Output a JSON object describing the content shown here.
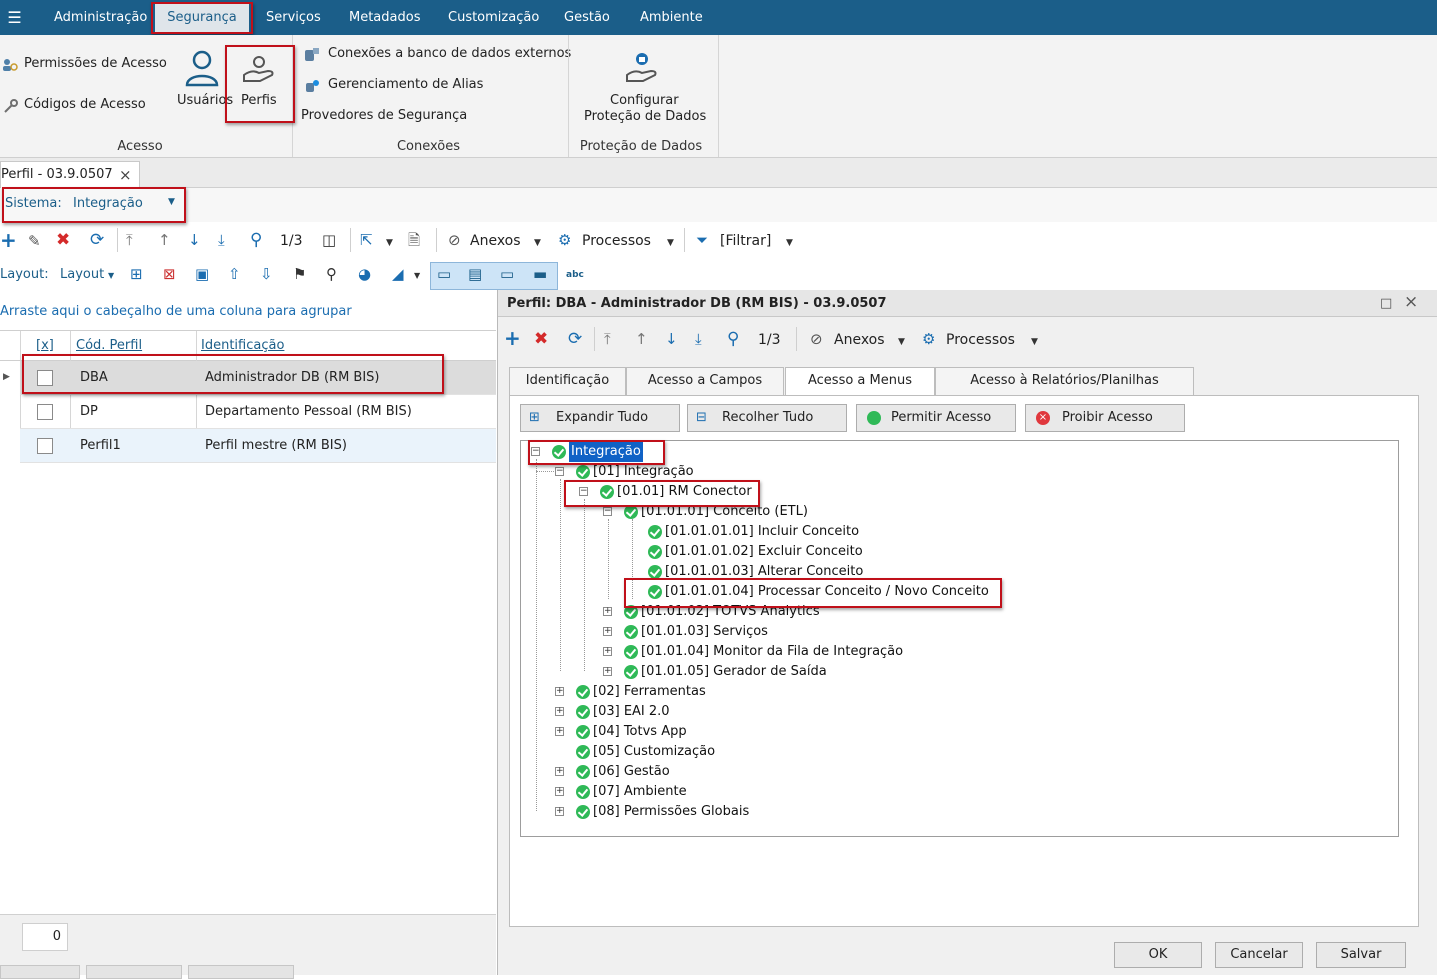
{
  "menu": {
    "items": [
      "Administração",
      "Segurança",
      "Serviços",
      "Metadados",
      "Customização",
      "Gestão",
      "Ambiente"
    ],
    "active": "Segurança"
  },
  "ribbon": {
    "acesso": {
      "permissoes": "Permissões de Acesso",
      "codigos": "Códigos de Acesso",
      "usuarios": "Usuários",
      "perfis": "Perfis",
      "group": "Acesso"
    },
    "conexoes": {
      "externos": "Conexões a banco de dados externos",
      "alias": "Gerenciamento de Alias",
      "provedores": "Provedores de Segurança",
      "group": "Conexões"
    },
    "protecao": {
      "line1": "Configurar",
      "line2": "Proteção de Dados",
      "group": "Proteção de Dados"
    }
  },
  "doc_tab": {
    "title": "Perfil - 03.9.0507",
    "close": "×"
  },
  "sistema": {
    "label": "Sistema:",
    "value": "Integração"
  },
  "toolbar": {
    "page": "1/3",
    "anexos": "Anexos",
    "processos": "Processos",
    "filtrar": "[Filtrar]"
  },
  "layout_bar": {
    "label": "Layout:",
    "menu": "Layout"
  },
  "grid": {
    "group_hint": "Arraste aqui o cabeçalho de uma coluna para agrupar",
    "headers": [
      "[x]",
      "Cód. Perfil",
      "Identificação"
    ],
    "rows": [
      {
        "code": "DBA",
        "name": "Administrador DB (RM BIS)"
      },
      {
        "code": "DP",
        "name": "Departamento Pessoal (RM BIS)"
      },
      {
        "code": "Perfil1",
        "name": "Perfil mestre (RM BIS)"
      }
    ],
    "count": "0"
  },
  "dialog": {
    "title": "Perfil: DBA - Administrador DB (RM BIS) - 03.9.0507",
    "toolbar": {
      "page": "1/3",
      "anexos": "Anexos",
      "processos": "Processos"
    },
    "tabs": [
      "Identificação",
      "Acesso a Campos",
      "Acesso a Menus",
      "Acesso à Relatórios/Planilhas"
    ],
    "actions": {
      "expand": "Expandir Tudo",
      "collapse": "Recolher Tudo",
      "allow": "Permitir Acesso",
      "deny": "Proibir Acesso"
    },
    "tree": [
      "Integração",
      "[01] Integração",
      "[01.01] RM Conector",
      "[01.01.01] Conceito (ETL)",
      "[01.01.01.01] Incluir Conceito",
      "[01.01.01.02] Excluir Conceito",
      "[01.01.01.03] Alterar Conceito",
      "[01.01.01.04] Processar Conceito / Novo Conceito",
      "[01.01.02] TOTVS Analytics",
      "[01.01.03] Serviços",
      "[01.01.04] Monitor da Fila de Integração",
      "[01.01.05] Gerador de  Saída",
      "[02] Ferramentas",
      "[03] EAI 2.0",
      "[04] Totvs App",
      "[05] Customização",
      "[06] Gestão",
      "[07] Ambiente",
      "[08] Permissões Globais"
    ],
    "footer": {
      "ok": "OK",
      "cancel": "Cancelar",
      "save": "Salvar"
    }
  },
  "colors": {
    "menubar": "#1b5e89",
    "highlight": "#c0101a",
    "ok_green": "#2fb957",
    "deny_red": "#e0383d"
  }
}
